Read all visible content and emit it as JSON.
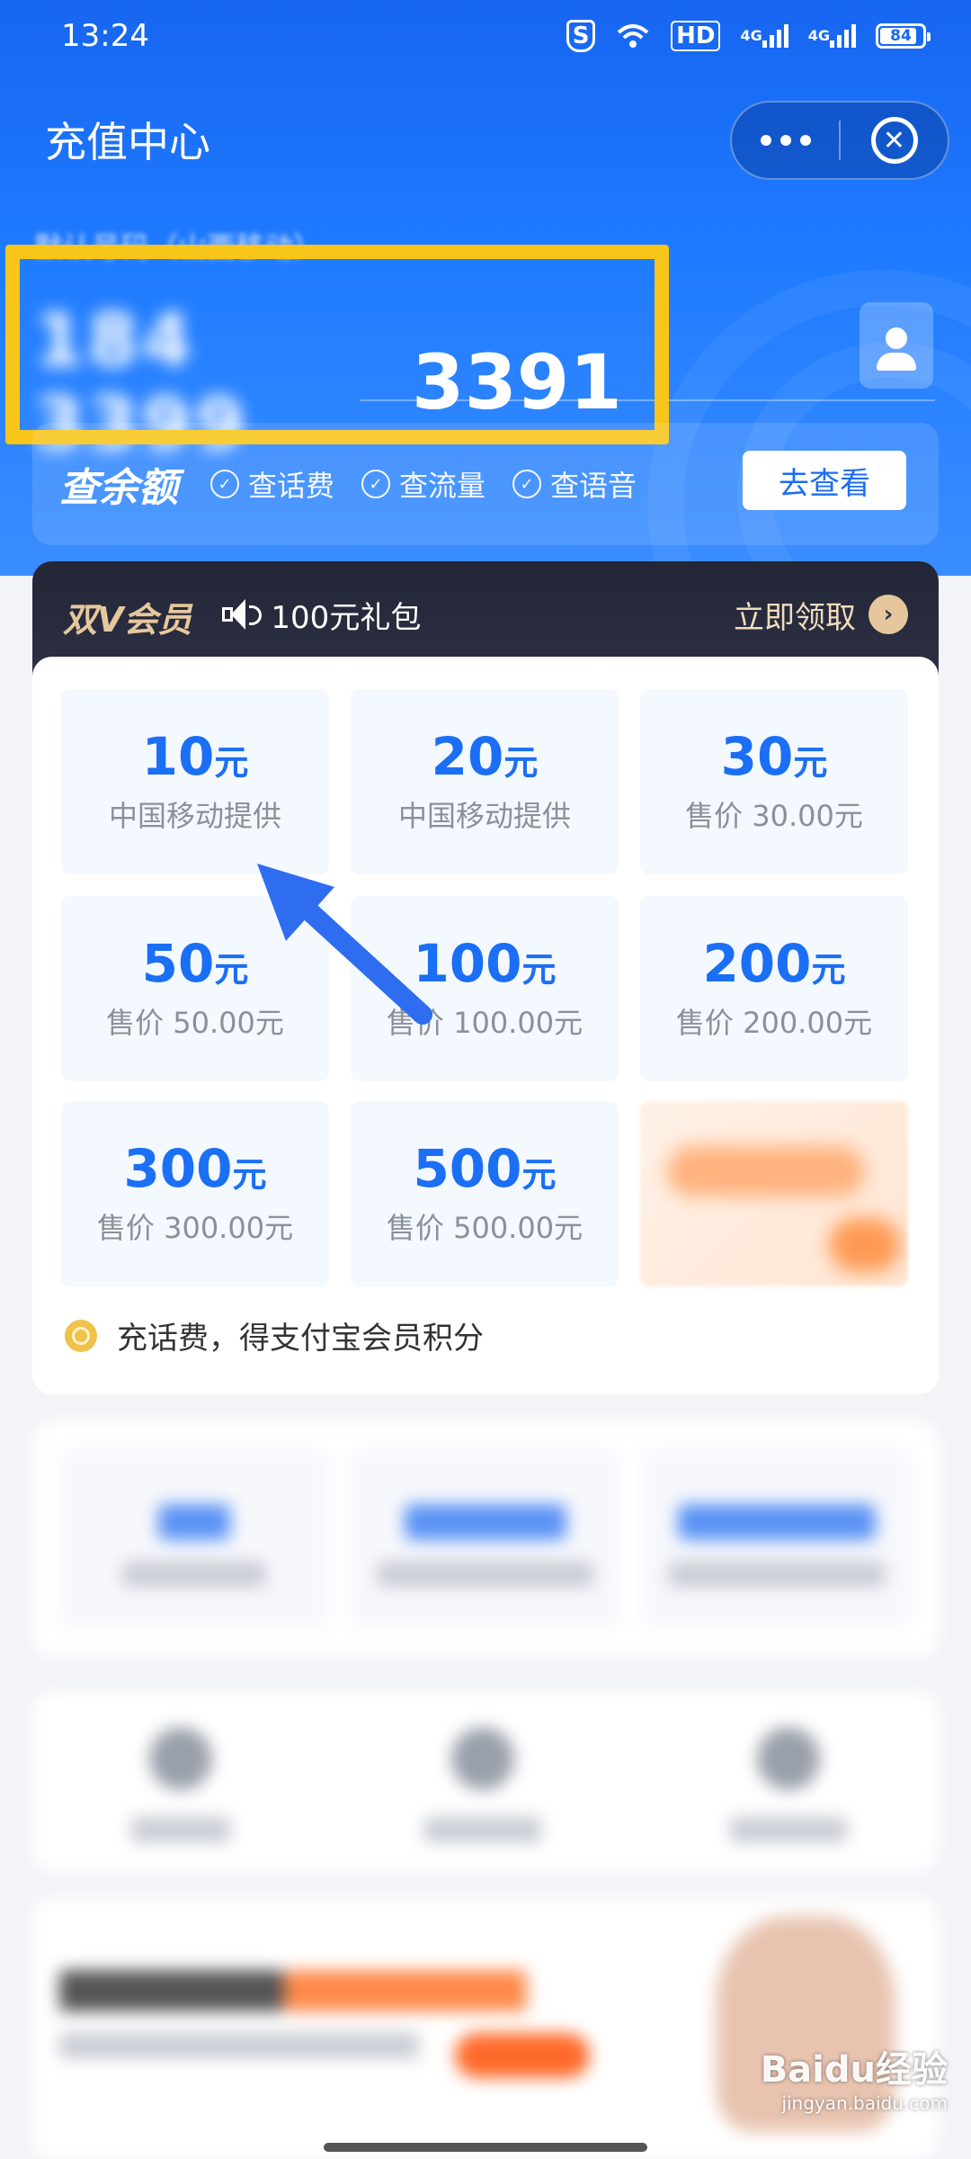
{
  "status_bar": {
    "time": "13:24",
    "hd_label": "HD",
    "signal_1": "4G",
    "signal_2": "4G",
    "battery": "84"
  },
  "header": {
    "title": "充值中心",
    "more_icon": "more-dots-icon",
    "close_icon": "close-circle-icon"
  },
  "phone": {
    "label": "默认号码（山西移动）",
    "number_hidden": "184 3399",
    "number_visible": "3391",
    "highlight_color": "#f8c51a"
  },
  "balance": {
    "title": "查余额",
    "checks": [
      "查话费",
      "查流量",
      "查语音"
    ],
    "button_label": "去查看"
  },
  "vip": {
    "title": "双V会员",
    "gift": "100元礼包",
    "claim": "立即领取"
  },
  "recharge": {
    "unit": "元",
    "options": [
      {
        "amount": "10",
        "note": "中国移动提供"
      },
      {
        "amount": "20",
        "note": "中国移动提供"
      },
      {
        "amount": "30",
        "note": "售价 30.00元"
      },
      {
        "amount": "50",
        "note": "售价 50.00元"
      },
      {
        "amount": "100",
        "note": "售价 100.00元"
      },
      {
        "amount": "200",
        "note": "售价 200.00元"
      },
      {
        "amount": "300",
        "note": "售价 300.00元"
      },
      {
        "amount": "500",
        "note": "售价 500.00元"
      }
    ],
    "note": "充话费，得支付宝会员积分"
  },
  "watermark": {
    "brand": "Baidu经验",
    "url": "jingyan.baidu.com"
  },
  "colors": {
    "primary_blue": "#1a6ff5",
    "vip_gold": "#e6c79d",
    "arrow_blue": "#2f6df0"
  }
}
